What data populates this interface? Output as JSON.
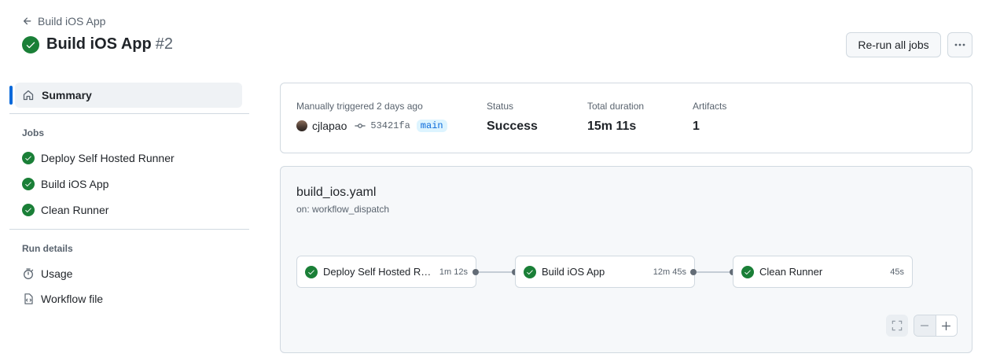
{
  "header": {
    "back_label": "Build iOS App",
    "title": "Build iOS App",
    "run_number": "#2",
    "rerun_label": "Re-run all jobs"
  },
  "sidebar": {
    "summary_label": "Summary",
    "jobs_heading": "Jobs",
    "jobs": [
      {
        "label": "Deploy Self Hosted Runner",
        "status": "success"
      },
      {
        "label": "Build iOS App",
        "status": "success"
      },
      {
        "label": "Clean Runner",
        "status": "success"
      }
    ],
    "run_details_heading": "Run details",
    "details": [
      {
        "label": "Usage",
        "icon": "stopwatch-icon"
      },
      {
        "label": "Workflow file",
        "icon": "file-code-icon"
      }
    ]
  },
  "summary": {
    "trigger_label": "Manually triggered 2 days ago",
    "user": "cjlapao",
    "commit_sha": "53421fa",
    "branch": "main",
    "status_label": "Status",
    "status_value": "Success",
    "duration_label": "Total duration",
    "duration_value": "15m 11s",
    "artifacts_label": "Artifacts",
    "artifacts_value": "1"
  },
  "workflow": {
    "file": "build_ios.yaml",
    "trigger": "on: workflow_dispatch",
    "jobs": [
      {
        "name": "Deploy Self Hosted Ru...",
        "duration": "1m 12s"
      },
      {
        "name": "Build iOS App",
        "duration": "12m 45s"
      },
      {
        "name": "Clean Runner",
        "duration": "45s"
      }
    ]
  },
  "colors": {
    "success": "#1a7f37",
    "accent": "#0969da"
  }
}
